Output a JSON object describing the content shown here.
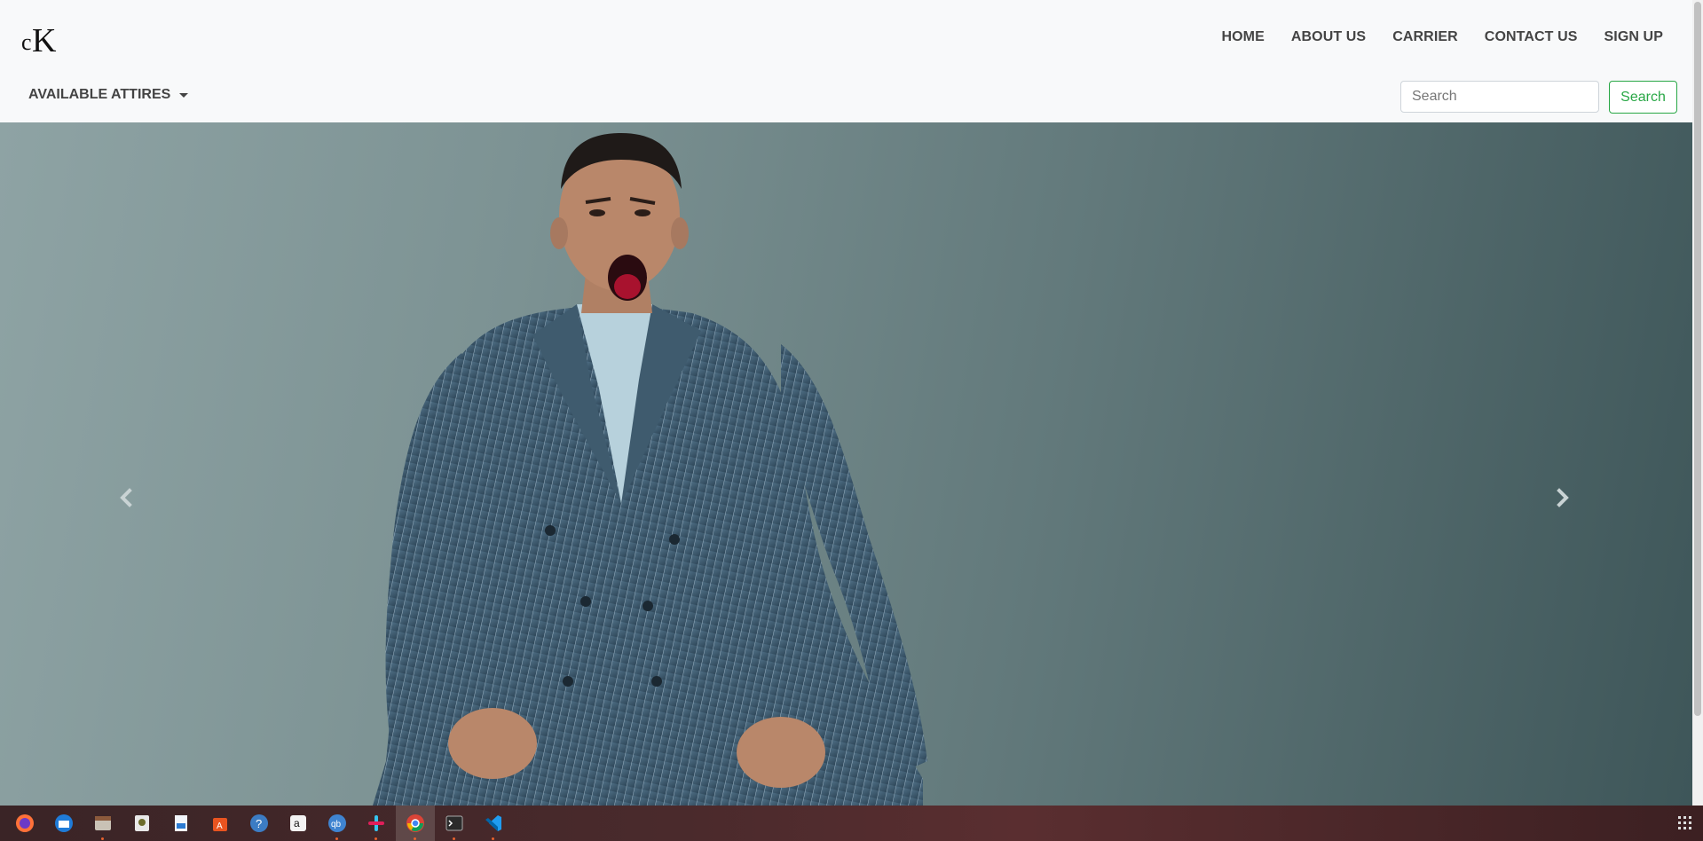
{
  "brand": {
    "logo_text": "cK"
  },
  "nav": {
    "links": [
      {
        "label": "HOME"
      },
      {
        "label": "ABOUT US"
      },
      {
        "label": "CARRIER"
      },
      {
        "label": "CONTACT US"
      },
      {
        "label": "SIGN UP"
      }
    ],
    "dropdown_label": "AVAILABLE ATTIRES"
  },
  "search": {
    "placeholder": "Search",
    "button_label": "Search"
  },
  "hero": {
    "prev_icon": "chevron-left-icon",
    "next_icon": "chevron-right-icon"
  },
  "colors": {
    "navbar_bg": "#f8f9fa",
    "nav_text": "#444444",
    "search_accent": "#28a745"
  },
  "taskbar": {
    "apps": [
      {
        "name": "firefox-icon"
      },
      {
        "name": "thunderbird-icon"
      },
      {
        "name": "file-manager-icon"
      },
      {
        "name": "disk-icon"
      },
      {
        "name": "writer-icon"
      },
      {
        "name": "software-center-icon"
      },
      {
        "name": "help-icon"
      },
      {
        "name": "amazon-icon"
      },
      {
        "name": "qbittorrent-icon"
      },
      {
        "name": "slack-icon"
      },
      {
        "name": "chrome-icon"
      },
      {
        "name": "terminal-icon"
      },
      {
        "name": "vscode-icon"
      }
    ]
  }
}
